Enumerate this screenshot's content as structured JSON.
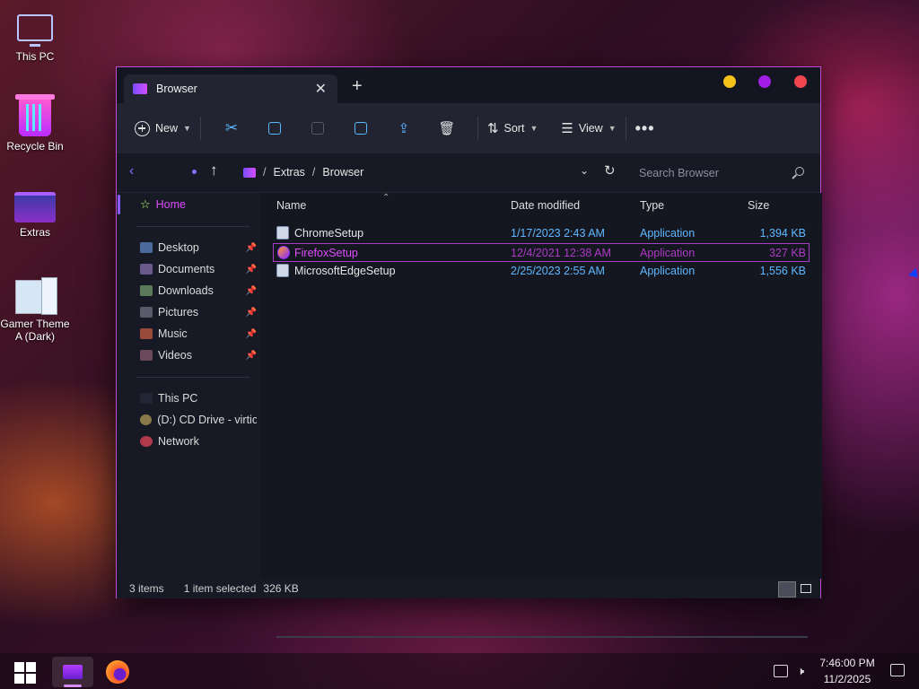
{
  "desktop": {
    "icons": [
      {
        "label": "This PC"
      },
      {
        "label": "Recycle Bin"
      },
      {
        "label": "Extras"
      },
      {
        "label": "Gamer Theme A (Dark)"
      }
    ]
  },
  "window": {
    "tab_title": "Browser",
    "colors": {
      "minimize": "#f4c21a",
      "maximize": "#a21ee6",
      "close": "#f0454f",
      "accent": "#e04cff"
    }
  },
  "toolbar": {
    "new_label": "New",
    "sort_label": "Sort",
    "view_label": "View",
    "more_label": "•••"
  },
  "address": {
    "crumbs": [
      "Extras",
      "Browser"
    ],
    "search_placeholder": "Search Browser"
  },
  "sidebar": {
    "home": "Home",
    "quick_access": [
      "Desktop",
      "Documents",
      "Downloads",
      "Pictures",
      "Music",
      "Videos"
    ],
    "devices": [
      "This PC",
      "(D:) CD Drive - virtio-",
      "Network"
    ]
  },
  "files": {
    "columns": {
      "name": "Name",
      "date": "Date modified",
      "type": "Type",
      "size": "Size"
    },
    "rows": [
      {
        "name": "ChromeSetup",
        "date": "1/17/2023 2:43 AM",
        "type": "Application",
        "size": "1,394 KB"
      },
      {
        "name": "FirefoxSetup",
        "date": "12/4/2021 12:38 AM",
        "type": "Application",
        "size": "327 KB"
      },
      {
        "name": "MicrosoftEdgeSetup",
        "date": "2/25/2023 2:55 AM",
        "type": "Application",
        "size": "1,556 KB"
      }
    ]
  },
  "status": {
    "items": "3 items",
    "selected": "1 item selected",
    "size": "326 KB"
  },
  "taskbar": {
    "time": "7:46:00 PM",
    "date": "11/2/2025"
  }
}
